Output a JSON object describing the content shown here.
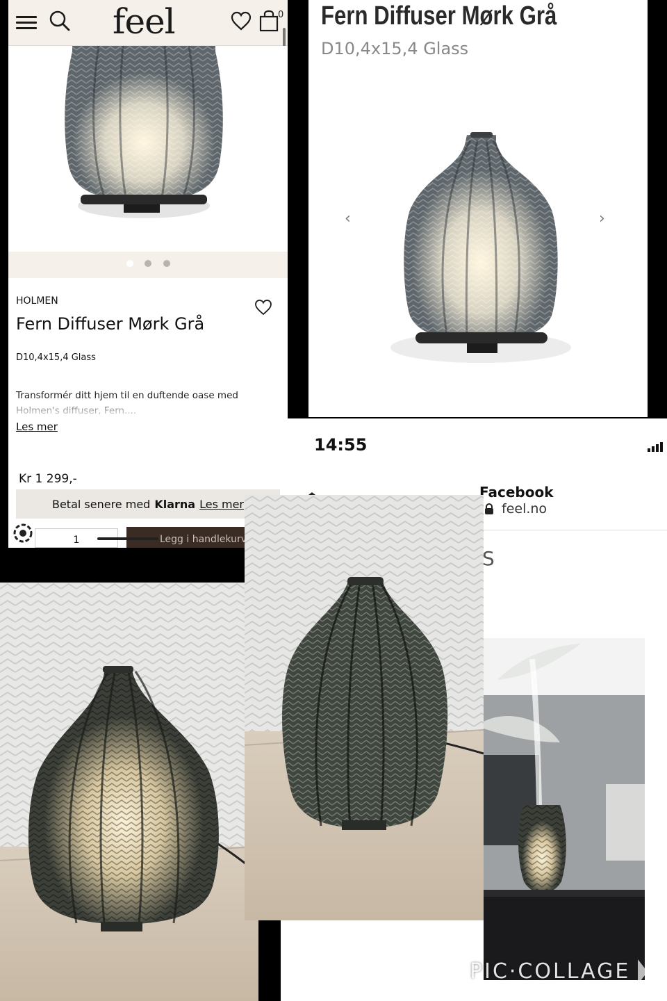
{
  "app": {
    "logo": "feel",
    "cart_count": "0",
    "brand": "HOLMEN",
    "product_title": "Fern Diffuser Mørk Grå",
    "product_size": "D10,4x15,4 Glass",
    "description": "Transformér ditt hjem til en duftende oase med Holmen's diffuser, Fern....",
    "read_more": "Les mer",
    "price": "Kr 1 299,-",
    "klarna_prefix": "Betal senere med",
    "klarna_brand": "Klarna",
    "klarna_link": "Les mer",
    "quantity": "1",
    "add_to_cart": "Legg i handlekurv",
    "carousel_dots": 3,
    "carousel_active": 0
  },
  "product_page": {
    "title": "Fern Diffuser Mørk Grå",
    "subtitle": "D10,4x15,4 Glass",
    "prev_arrow": "‹",
    "next_arrow": "›"
  },
  "browser": {
    "time": "14:55",
    "site_title": "Facebook",
    "url": "feel.no",
    "partial_text": "S"
  },
  "watermark": "PIC·COLLAGE",
  "colors": {
    "header_bg": "#f5f0ea",
    "glass_gray": "#5e666b",
    "glass_dark": "#2e332e",
    "warm_light": "#f1e5c8",
    "add_to_cart_bg": "#3a2c24"
  }
}
